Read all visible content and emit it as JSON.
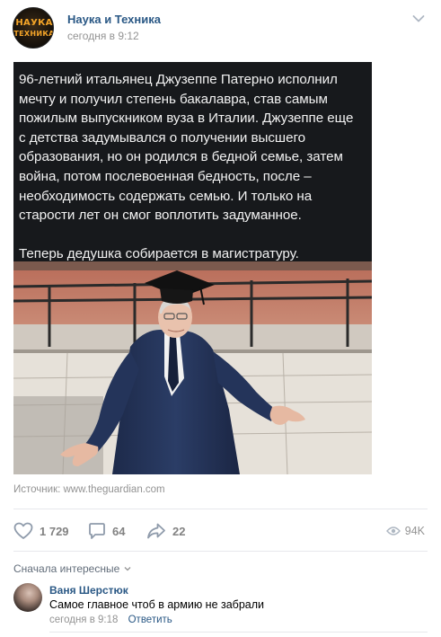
{
  "header": {
    "group_name": "Наука и Техника",
    "time": "сегодня в 9:12",
    "avatar_top": "НАУКА",
    "avatar_bottom": "ТЕХНИКА"
  },
  "post": {
    "text": "96-летний итальянец Джузеппе Патерно исполнил мечту и получил степень бакалавра, став самым пожилым выпускником вуза в Италии. Джузеппе еще с детства задумывался о получении высшего образования, но он родился в бедной семье, затем война, потом послевоенная бедность, после – необходимость содержать семью. И только на старости лет он смог воплотить задуманное.\n\nТеперь дедушка собирается в магистратуру.",
    "source_label": "Источник:",
    "source_link": "www.theguardian.com"
  },
  "actions": {
    "likes": "1 729",
    "comments": "64",
    "shares": "22",
    "views": "94K"
  },
  "comments_section": {
    "sort_label": "Сначала интересные",
    "items": [
      {
        "author": "Ваня Шерстюк",
        "text": "Самое главное чтоб в армию не забрали",
        "time": "сегодня в 9:18",
        "reply_label": "Ответить"
      }
    ]
  },
  "colors": {
    "link": "#2a5885",
    "muted": "#939393",
    "text_panel_bg": "#17191c"
  }
}
